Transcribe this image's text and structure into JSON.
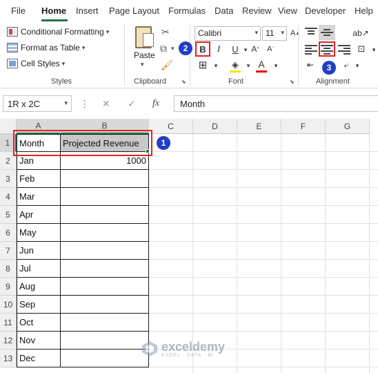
{
  "menu": {
    "tabs": [
      "File",
      "Home",
      "Insert",
      "Page Layout",
      "Formulas",
      "Data",
      "Review",
      "View",
      "Developer",
      "Help"
    ],
    "active": "Home"
  },
  "ribbon": {
    "styles": {
      "items": [
        "Conditional Formatting",
        "Format as Table",
        "Cell Styles"
      ],
      "label": "Styles"
    },
    "clipboard": {
      "paste_label": "Paste",
      "label": "Clipboard"
    },
    "font": {
      "name": "Calibri",
      "size": "11",
      "bold": "B",
      "italic": "I",
      "underline": "U",
      "label": "Font"
    },
    "alignment": {
      "label": "Alignment"
    }
  },
  "formula_bar": {
    "name_box": "1R x 2C",
    "fx": "fx",
    "value": "Month"
  },
  "sheet": {
    "columns": [
      "A",
      "B",
      "C",
      "D",
      "E",
      "F",
      "G"
    ],
    "rows": [
      "1",
      "2",
      "3",
      "4",
      "5",
      "6",
      "7",
      "8",
      "9",
      "10",
      "11",
      "12",
      "13"
    ],
    "header": [
      "Month",
      "Projected Revenue"
    ],
    "months": [
      "Jan",
      "Feb",
      "Mar",
      "Apr",
      "May",
      "Jun",
      "Jul",
      "Aug",
      "Sep",
      "Oct",
      "Nov",
      "Dec"
    ],
    "values": [
      "1000",
      "",
      "",
      "",
      "",
      "",
      "",
      "",
      "",
      "",
      "",
      ""
    ]
  },
  "badges": [
    "1",
    "2",
    "3"
  ],
  "watermark": {
    "name": "exceldemy",
    "tagline": "EXCEL · DATA · BI"
  },
  "colors": {
    "accent": "#217346",
    "highlight": "#e02020",
    "badge": "#1f3fc4",
    "selection": "#c8c8c8"
  }
}
